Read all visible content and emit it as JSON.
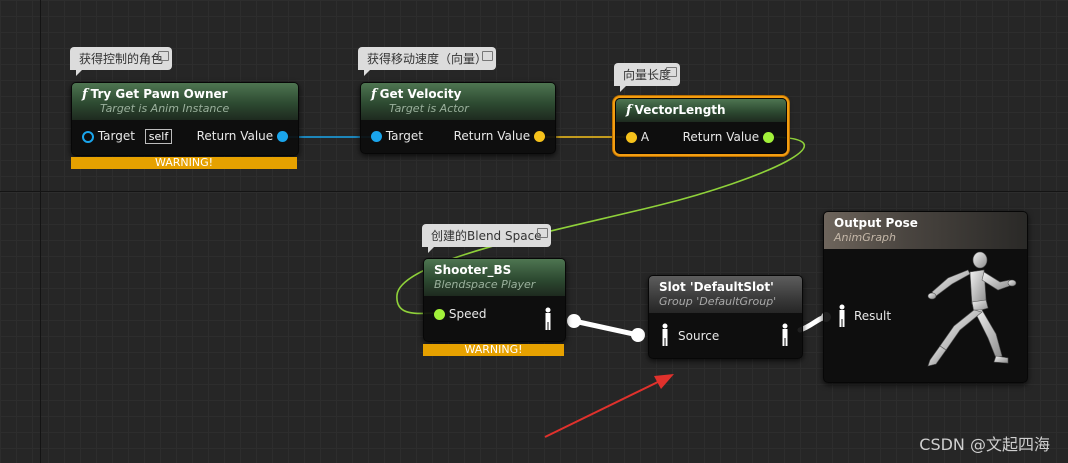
{
  "comments": {
    "try_get_pawn": "获得控制的角色",
    "get_velocity": "获得移动速度（向量）",
    "vector_length": "向量长度",
    "shooter_bs": "创建的Blend Space"
  },
  "nodes": {
    "try_get_pawn": {
      "title": "Try Get Pawn Owner",
      "subtitle": "Target is Anim Instance",
      "input_label": "Target",
      "input_default": "self",
      "output_label": "Return Value",
      "warning": "WARNING!"
    },
    "get_velocity": {
      "title": "Get Velocity",
      "subtitle": "Target is Actor",
      "input_label": "Target",
      "output_label": "Return Value"
    },
    "vector_length": {
      "title": "VectorLength",
      "input_label": "A",
      "output_label": "Return Value"
    },
    "shooter_bs": {
      "title": "Shooter_BS",
      "subtitle": "Blendspace Player",
      "input_label": "Speed",
      "warning": "WARNING!"
    },
    "slot": {
      "title": "Slot 'DefaultSlot'",
      "subtitle": "Group 'DefaultGroup'",
      "input_label": "Source"
    },
    "output_pose": {
      "title": "Output Pose",
      "subtitle": "AnimGraph",
      "input_label": "Result"
    }
  },
  "function_glyph": "f",
  "watermark": "CSDN @文起四海",
  "colors": {
    "object_pin": "#1aa5ec",
    "vector_pin": "#f6c21b",
    "float_pin": "#a2f13a",
    "pose_wire": "#ffffff",
    "selection": "#f39d11",
    "warning": "#e6a100",
    "annotation_arrow": "#e0312c"
  }
}
